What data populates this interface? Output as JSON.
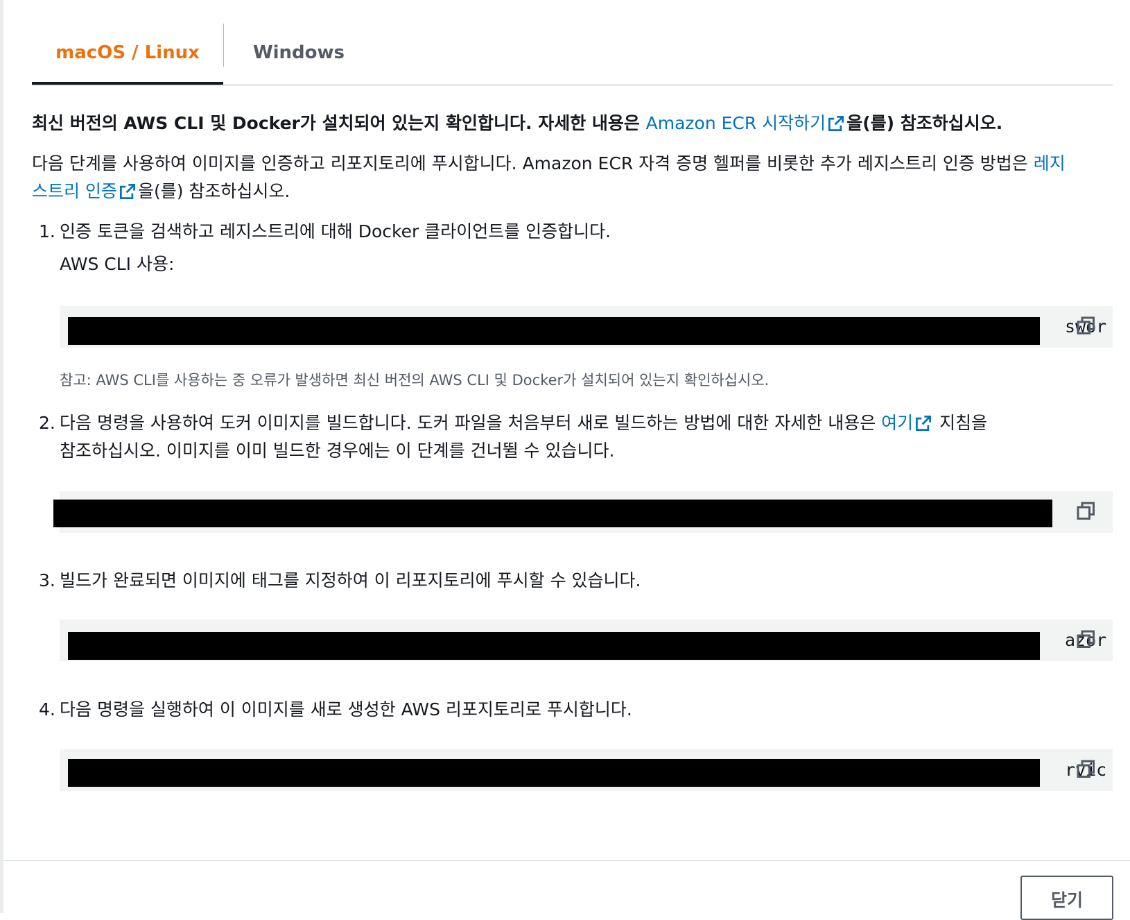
{
  "tabs": [
    {
      "label": "macOS / Linux",
      "active": true
    },
    {
      "label": "Windows",
      "active": false
    }
  ],
  "intro": {
    "line1_bold": "최신 버전의 AWS CLI 및 Docker가 설치되어 있는지 확인합니다. 자세한 내용은 ",
    "line1_link": "Amazon ECR 시작하기",
    "line1_suffix": "을(를) 참조하십시오.",
    "line2_text": "다음 단계를 사용하여 이미지를 인증하고 리포지토리에 푸시합니다. Amazon ECR 자격 증명 헬퍼를 비롯한 추가 레지스트리 인증 방법은 ",
    "line2_link_a": "레지",
    "line2_link_b": "스트리 인증",
    "line2_suffix": "을(를) 참조하십시오."
  },
  "steps": [
    {
      "number": "1.",
      "text": "인증 토큰을 검색하고 레지스트리에 대해 Docker 클라이언트를 인증합니다.",
      "sublabel": "AWS CLI 사용:",
      "code_tail": "swor",
      "note": "참고: AWS CLI를 사용하는 중 오류가 발생하면 최신 버전의 AWS CLI 및 Docker가 설치되어 있는지 확인하십시오."
    },
    {
      "number": "2.",
      "text_a": "다음 명령을 사용하여 도커 이미지를 빌드합니다. 도커 파일을 처음부터 새로 빌드하는 방법에 대한 자세한 내용은 ",
      "link": "여기",
      "text_b": " 지침을",
      "text_line2": "참조하십시오. 이미지를 이미 빌드한 경우에는 이 단계를 건너뛸 수 있습니다."
    },
    {
      "number": "3.",
      "text": "빌드가 완료되면 이미지에 태그를 지정하여 이 리포지토리에 푸시할 수 있습니다.",
      "code_tail": "azor"
    },
    {
      "number": "4.",
      "text": "다음 명령을 실행하여 이 이미지를 새로 생성한 AWS 리포지토리로 푸시합니다.",
      "code_tail": "rvic"
    }
  ],
  "footer": {
    "close_label": "닫기"
  },
  "colors": {
    "accent": "#ec7211",
    "link": "#0073bb",
    "code_bg": "#f2f3f3"
  }
}
